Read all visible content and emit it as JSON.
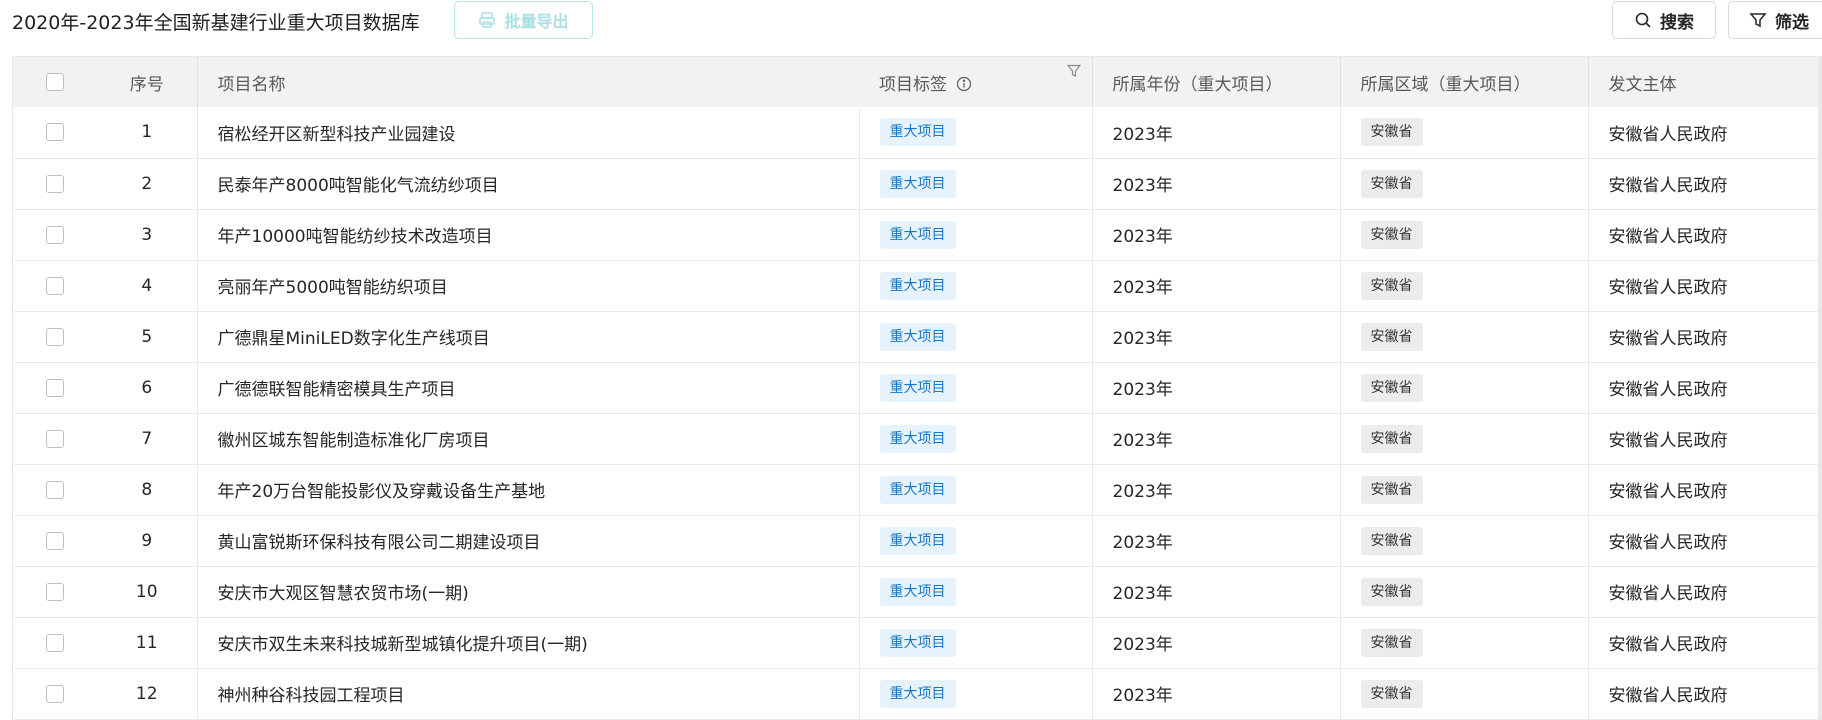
{
  "header": {
    "title": "2020年-2023年全国新基建行业重大项目数据库",
    "export_label": "批量导出",
    "search_label": "搜索",
    "filter_label": "筛选"
  },
  "table": {
    "columns": {
      "seq": "序号",
      "name": "项目名称",
      "tag": "项目标签",
      "year": "所属年份（重大项目）",
      "region": "所属区域（重大项目）",
      "issuer": "发文主体"
    },
    "rows": [
      {
        "seq": "1",
        "name": "宿松经开区新型科技产业园建设",
        "tag": "重大项目",
        "year": "2023年",
        "region": "安徽省",
        "issuer": "安徽省人民政府"
      },
      {
        "seq": "2",
        "name": "民泰年产8000吨智能化气流纺纱项目",
        "tag": "重大项目",
        "year": "2023年",
        "region": "安徽省",
        "issuer": "安徽省人民政府"
      },
      {
        "seq": "3",
        "name": "年产10000吨智能纺纱技术改造项目",
        "tag": "重大项目",
        "year": "2023年",
        "region": "安徽省",
        "issuer": "安徽省人民政府"
      },
      {
        "seq": "4",
        "name": "亮丽年产5000吨智能纺织项目",
        "tag": "重大项目",
        "year": "2023年",
        "region": "安徽省",
        "issuer": "安徽省人民政府"
      },
      {
        "seq": "5",
        "name": "广德鼎星MiniLED数字化生产线项目",
        "tag": "重大项目",
        "year": "2023年",
        "region": "安徽省",
        "issuer": "安徽省人民政府"
      },
      {
        "seq": "6",
        "name": "广德德联智能精密模具生产项目",
        "tag": "重大项目",
        "year": "2023年",
        "region": "安徽省",
        "issuer": "安徽省人民政府"
      },
      {
        "seq": "7",
        "name": "徽州区城东智能制造标准化厂房项目",
        "tag": "重大项目",
        "year": "2023年",
        "region": "安徽省",
        "issuer": "安徽省人民政府"
      },
      {
        "seq": "8",
        "name": "年产20万台智能投影仪及穿戴设备生产基地",
        "tag": "重大项目",
        "year": "2023年",
        "region": "安徽省",
        "issuer": "安徽省人民政府"
      },
      {
        "seq": "9",
        "name": "黄山富锐斯环保科技有限公司二期建设项目",
        "tag": "重大项目",
        "year": "2023年",
        "region": "安徽省",
        "issuer": "安徽省人民政府"
      },
      {
        "seq": "10",
        "name": "安庆市大观区智慧农贸市场(一期)",
        "tag": "重大项目",
        "year": "2023年",
        "region": "安徽省",
        "issuer": "安徽省人民政府"
      },
      {
        "seq": "11",
        "name": "安庆市双生未来科技城新型城镇化提升项目(一期)",
        "tag": "重大项目",
        "year": "2023年",
        "region": "安徽省",
        "issuer": "安徽省人民政府"
      },
      {
        "seq": "12",
        "name": "神州种谷科技园工程项目",
        "tag": "重大项目",
        "year": "2023年",
        "region": "安徽省",
        "issuer": "安徽省人民政府"
      }
    ]
  },
  "icons": {
    "export": "printer-icon",
    "search": "search-icon",
    "filter": "funnel-icon",
    "info": "info-circle-icon",
    "column_filter": "column-filter-icon"
  },
  "colors": {
    "tag_text": "#1677c9",
    "tag_bg": "#e6f3fc",
    "export_disabled": "#a9dfe2"
  }
}
